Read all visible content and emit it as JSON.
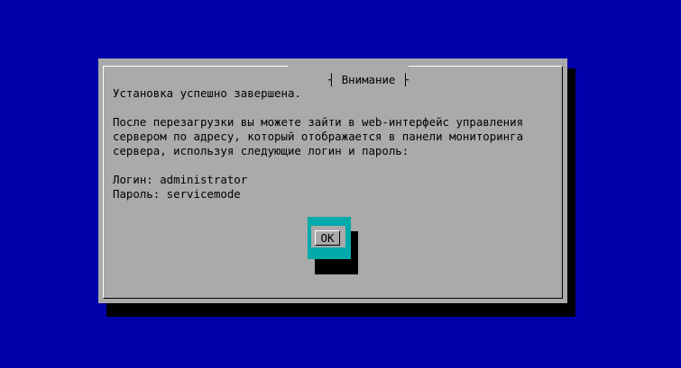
{
  "dialog": {
    "title": "Внимание",
    "lines": [
      "Установка успешно завершена.",
      "После перезагрузки вы можете зайти в web-интерфейс управления",
      "сервером по адресу, который отображается в панели мониторинга",
      "сервера, используя следующие логин и пароль:",
      "Логин: administrator",
      "Пароль: servicemode"
    ],
    "ok_label": "OK"
  },
  "colors": {
    "background": "#0000aa",
    "dialog": "#aaaaaa",
    "focus": "#00aaaa",
    "shadow": "#000000"
  }
}
